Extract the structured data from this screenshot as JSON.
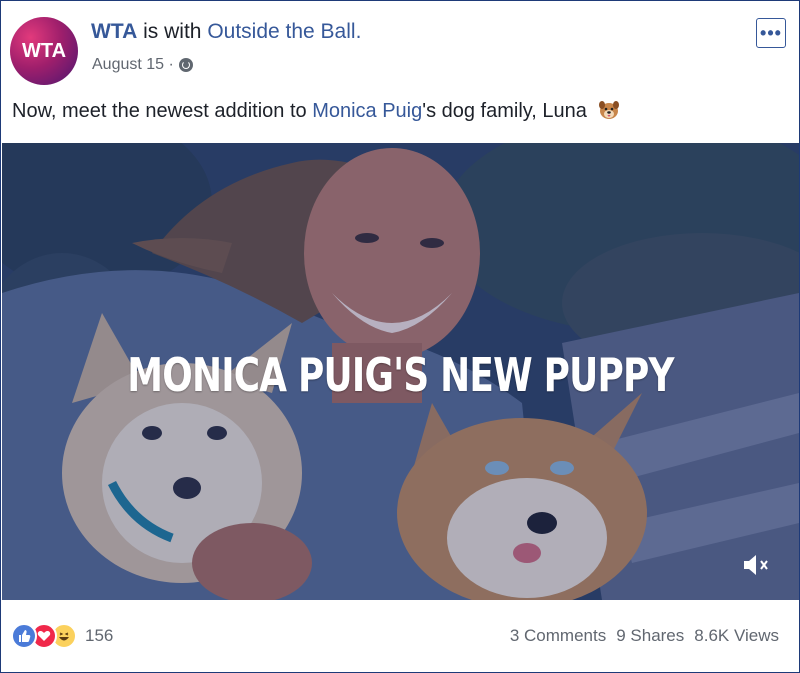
{
  "post": {
    "author": "WTA",
    "is_with_text": "is with",
    "with_page": "Outside the Ball.",
    "avatar_text": "WTA",
    "date": "August 15 ·",
    "caption_before": "Now, meet the newest addition to ",
    "caption_link": "Monica Puig",
    "caption_after": "'s dog family, Luna",
    "more_label": "•••"
  },
  "video": {
    "overlay_title": "MONICA PUIG'S NEW PUPPY"
  },
  "footer": {
    "reaction_count": "156",
    "comments": "3 Comments",
    "shares": "9 Shares",
    "views": "8.6K Views"
  },
  "colors": {
    "link": "#365899",
    "like": "#4b7bd8",
    "love": "#f0284a",
    "haha": "#fbd15d",
    "border": "#1e3a78"
  },
  "icons": [
    "globe-icon",
    "more-options-icon",
    "dog-face-icon",
    "mute-icon",
    "like-reaction-icon",
    "love-reaction-icon",
    "haha-reaction-icon"
  ]
}
